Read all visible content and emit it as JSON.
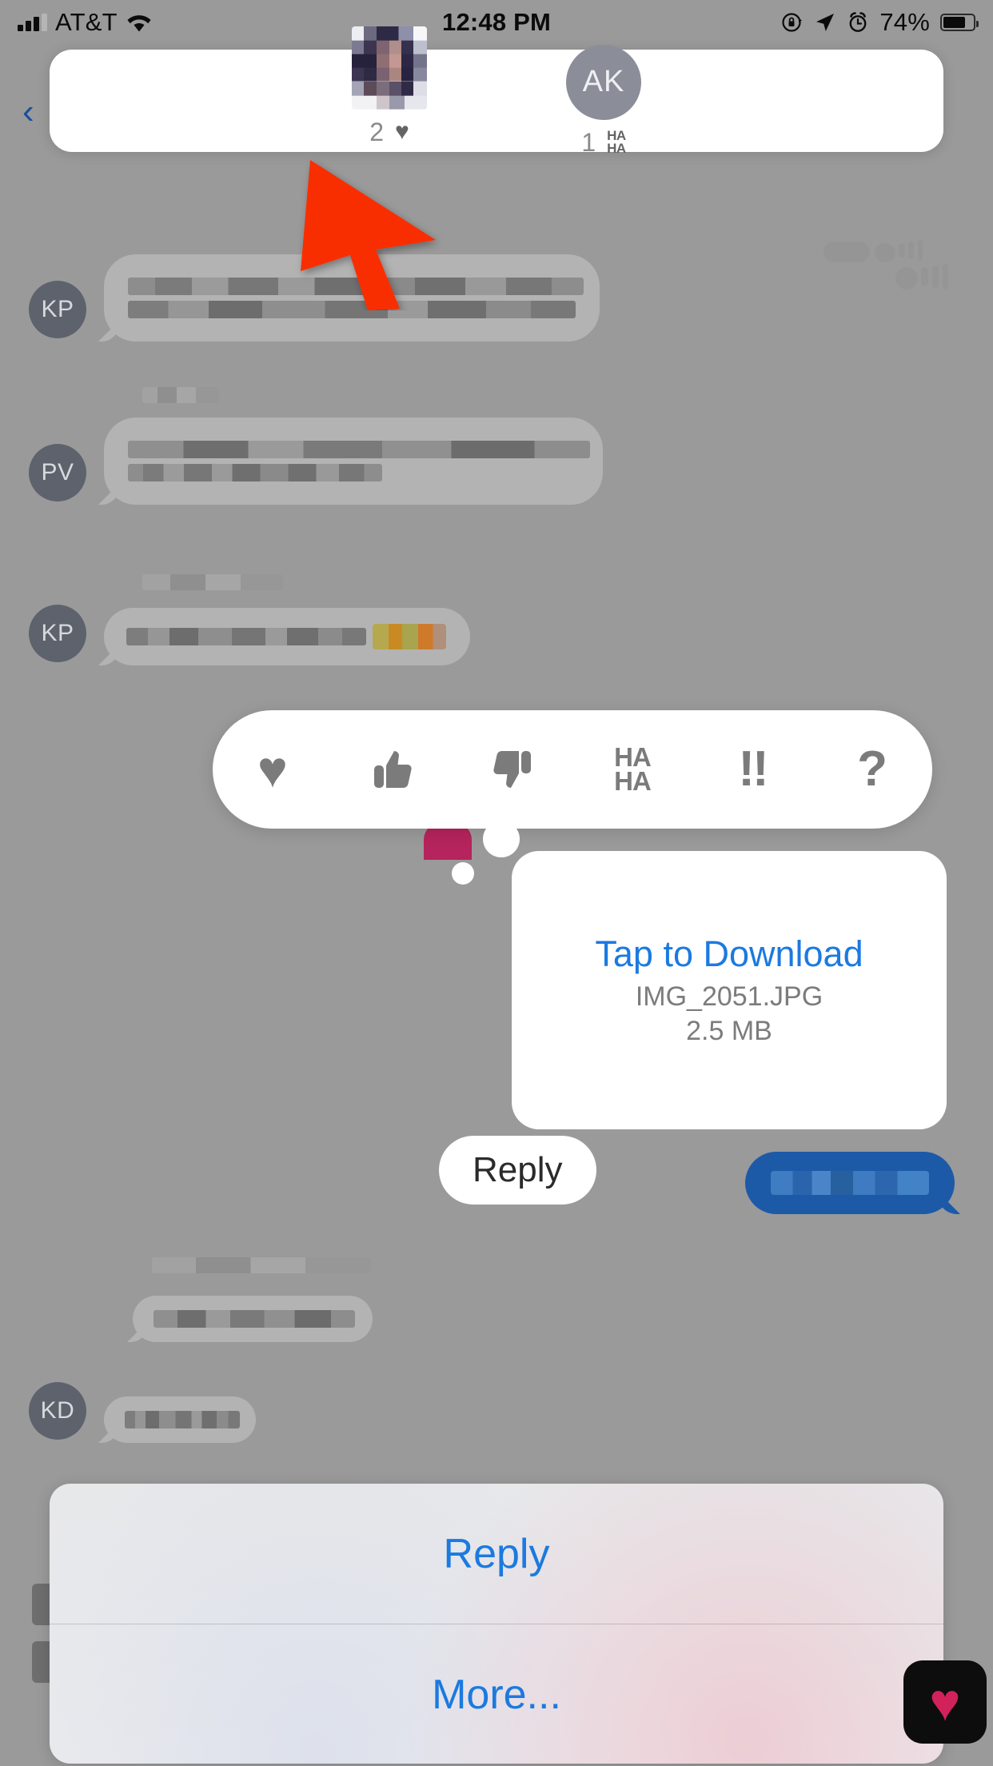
{
  "status_bar": {
    "carrier": "AT&T",
    "time": "12:48 PM",
    "battery_percent": "74%",
    "icons": [
      "signal-bars-icon",
      "wifi-icon",
      "rotation-lock-icon",
      "location-arrow-icon",
      "alarm-clock-icon",
      "battery-icon"
    ]
  },
  "nav": {
    "back_chevron": "‹"
  },
  "reaction_panel": {
    "reactors": [
      {
        "avatar_type": "photo",
        "initials": "",
        "count": "2",
        "reaction": "heart",
        "reaction_glyph": "♥",
        "reaction_label": ""
      },
      {
        "avatar_type": "initials",
        "initials": "AK",
        "count": "1",
        "reaction": "haha",
        "reaction_glyph": "",
        "reaction_label_top": "HA",
        "reaction_label_bottom": "HA"
      }
    ]
  },
  "tapback_bar": {
    "options": [
      {
        "name": "heart",
        "glyph": "♥",
        "style": "tb-heart"
      },
      {
        "name": "thumbs-up",
        "glyph": "👍",
        "style": "tb-thumb"
      },
      {
        "name": "thumbs-down",
        "glyph": "👎",
        "style": "tb-thumb"
      },
      {
        "name": "haha",
        "glyph": "HA\nHA",
        "style": "tb-haha"
      },
      {
        "name": "exclamation",
        "glyph": "!!",
        "style": "tb-bang"
      },
      {
        "name": "question",
        "glyph": "?",
        "style": "tb-q"
      }
    ]
  },
  "attachment": {
    "action_label": "Tap to Download",
    "filename": "IMG_2051.JPG",
    "filesize": "2.5 MB"
  },
  "reply_pill": {
    "label": "Reply"
  },
  "action_sheet": {
    "buttons": [
      {
        "name": "reply",
        "label": "Reply"
      },
      {
        "name": "more",
        "label": "More..."
      }
    ]
  },
  "conversation": {
    "messages": [
      {
        "sender_initials": "KP",
        "type": "incoming",
        "redacted": true
      },
      {
        "sender_initials": "PV",
        "type": "incoming",
        "redacted": true
      },
      {
        "sender_initials": "KP",
        "type": "incoming",
        "redacted": true,
        "has_emoji": true
      },
      {
        "sender_initials": "",
        "type": "outgoing",
        "redacted": true
      },
      {
        "sender_initials": "KD",
        "type": "incoming",
        "redacted": true
      }
    ]
  },
  "annotation": {
    "type": "arrow",
    "color": "#F92D00",
    "points_to": "reaction-panel-heart-avatar"
  },
  "app_drawer": {
    "icon": "heart-app-icon"
  },
  "colors": {
    "accent_blue": "#1b7ae0",
    "sent_bubble": "#1c5aa8",
    "received_bubble": "#b3b3b3",
    "dim_overlay": "#9a9a9a",
    "annotation_red": "#F92D00"
  }
}
